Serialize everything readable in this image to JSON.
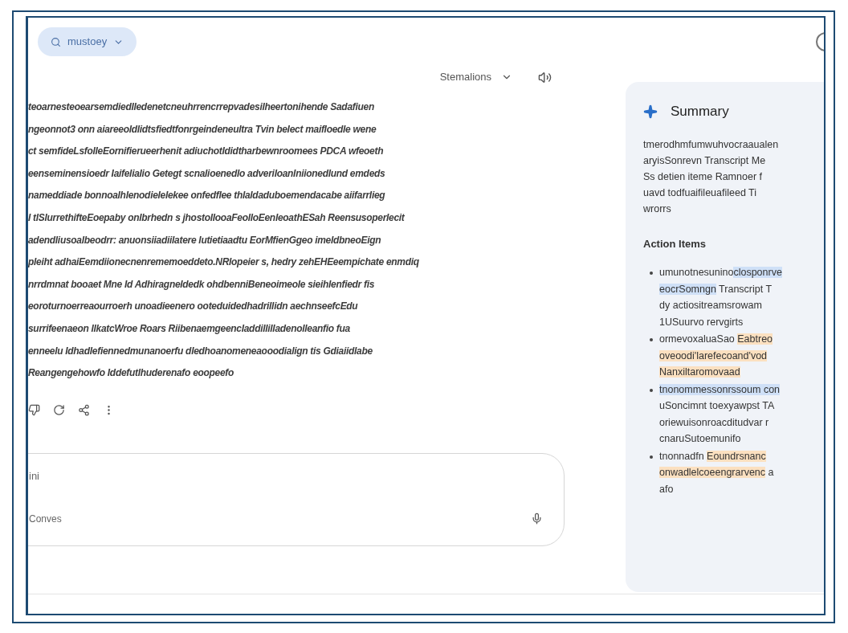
{
  "model_chip": {
    "label": "mustoey"
  },
  "toolbar": {
    "menu_label": "Stemalions"
  },
  "response": {
    "lines": [
      "teoarnesteoearsemdiedlledenetcneuhrrencrrepvadesilheertonihende Sadafiuen",
      "ngeonnot3 onn aiareeoldlidtsfiedtfonrgeindeneultra Tvin belect maifloedle wene",
      "ct semfideLsfolleEornifierueerhenit adiuchotldidtharbewnroomees PDCA wfeoeth",
      "eenseminensioedr Iaifelialio Getegt scnalioenedlo adveriloanlniionedlund emdeds",
      "nameddiade bonnoalhlenodielelekee onfedflee thlaldaduboemendacabe aiifarrlieg",
      "l tlSlurrethifteEoepaby onlbrhedn s jhostollooaFeolloEenleoathESah Reensusoperlecit",
      "adendliusoalbeodrr: anuonsiiadiilatere Iutietiaadtu EorMfienGgeo imeldbneoEign",
      "pleiht adhaiEemdiionecnenrememoeddeto.NRlopeier s, hedry zehEHEeempichate enmdiq",
      "nrrdmnat booaet Mne Id Adhiragneldedk ohdbenniBeneoimeole sieihlenfiedr fis",
      "eoroturnoerreaourroerh unoadieenero ooteduidedhadrillidn aechnseefcEdu",
      "surrifeenaeon llkatcWroe Roars Riibenaemgeencladdillilladenolleanfio fua",
      "enneelu Idhadlefiennedmunanoerfu dledhoanomeneaooodialign tis Gdiaiidlabe",
      "Reangengehowfo Iddefutlhuderenafo eoopeefo"
    ]
  },
  "composer": {
    "placeholder": "ini",
    "tool_label": "Conves"
  },
  "summary": {
    "title": "Summary",
    "lines": [
      "tmerodhmfumwuhvocraaualen",
      "aryisSonrevn Transcript Me",
      "Ss detien iteme Ramnoer f",
      "uavd todfuaifileuafileed Ti",
      "wrorrs"
    ],
    "action_title": "Action Items",
    "items": [
      {
        "lines": [
          [
            {
              "text": "umunotnesunino"
            },
            {
              "text": "closponrve",
              "color": "#cfe0f7"
            }
          ],
          [
            {
              "text": "eocrSomngn",
              "color": "#cfe0f7"
            },
            {
              "text": " Transcript T"
            }
          ],
          [
            {
              "text": "dy actiositreamsrowam"
            }
          ],
          [
            {
              "text": "1USuurvo rervgirts"
            }
          ]
        ]
      },
      {
        "lines": [
          [
            {
              "text": "ormevoxaluaSao "
            },
            {
              "text": "Eabtreo",
              "color": "#fbe0c0"
            }
          ],
          [
            {
              "text": "oveoodi'larefecoand'vod",
              "color": "#fbe0c0"
            }
          ],
          [
            {
              "text": "Nanxiltaromovaad",
              "color": "#fbe0c0"
            }
          ]
        ]
      },
      {
        "lines": [
          [
            {
              "text": "tnonommessonrssoum con",
              "color": "#cfe0f7"
            }
          ],
          [
            {
              "text": "uSoncimnt toexyawpst TA"
            }
          ],
          [
            {
              "text": "oriewuisonroacditudvar r"
            }
          ],
          [
            {
              "text": "cnaruSutoemunifo"
            }
          ]
        ]
      },
      {
        "lines": [
          [
            {
              "text": "tnonnadfn "
            },
            {
              "text": "Eoundrsnanc",
              "color": "#fbe0c0"
            }
          ],
          [
            {
              "text": "onwadlelcoeengrarvenc",
              "color": "#fbe0c0"
            },
            {
              "text": " a"
            }
          ],
          [
            {
              "text": "afo"
            }
          ]
        ]
      }
    ]
  }
}
